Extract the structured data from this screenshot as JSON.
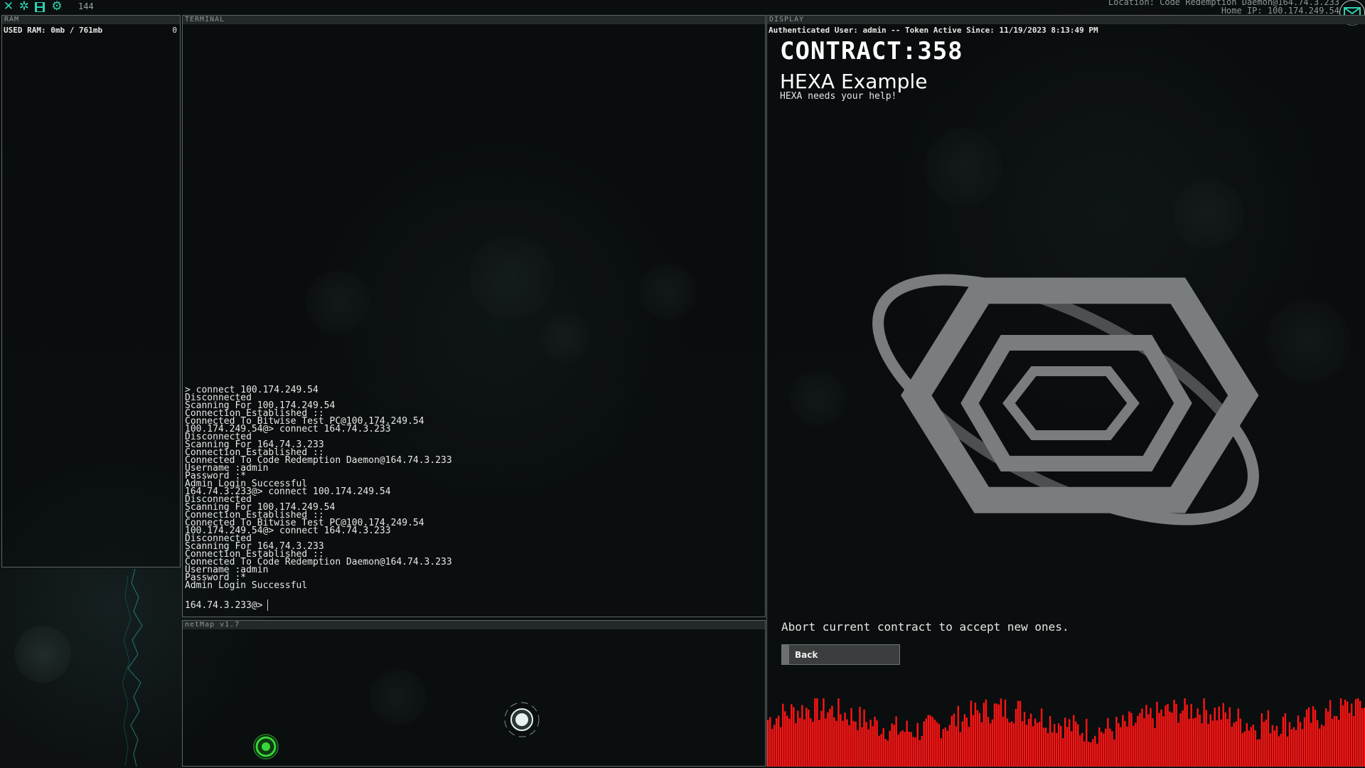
{
  "topbar": {
    "icons": [
      "close-icon",
      "settings-icon",
      "save-icon",
      "gear-icon"
    ],
    "count": "144",
    "location_line": "Location: Code Redemption Daemon@164.74.3.233",
    "home_ip_line": "Home IP: 100.174.249.54"
  },
  "ram": {
    "header": "RAM",
    "used": "USED RAM: 0mb / 761mb",
    "count": "0"
  },
  "terminal": {
    "header": "TERMINAL",
    "log": [
      "> connect 100.174.249.54",
      "Disconnected",
      "Scanning For 100.174.249.54",
      "Connection Established ::",
      "Connected To Bitwise Test PC@100.174.249.54",
      "100.174.249.54@> connect 164.74.3.233",
      "Disconnected",
      "Scanning For 164.74.3.233",
      "Connection Established ::",
      "Connected To Code Redemption Daemon@164.74.3.233",
      "Username :admin",
      "Password :*",
      "Admin Login Successful",
      "164.74.3.233@> connect 100.174.249.54",
      "Disconnected",
      "Scanning For 100.174.249.54",
      "Connection Established ::",
      "Connected To Bitwise Test PC@100.174.249.54",
      "100.174.249.54@> connect 164.74.3.233",
      "Disconnected",
      "Scanning For 164.74.3.233",
      "Connection Established ::",
      "Connected To Code Redemption Daemon@164.74.3.233",
      "Username :admin",
      "Password :*",
      "Admin Login Successful"
    ],
    "prompt": "164.74.3.233@>"
  },
  "netmap": {
    "header": "netMap v1.7",
    "colors": {
      "home_node": "#37d63a",
      "remote_node": "#e8f2f2"
    }
  },
  "display": {
    "header": "DISPLAY",
    "auth_line": "Authenticated User: admin -- Token Active Since: 11/19/2023 8:13:49 PM",
    "contract_title": "CONTRACT:358",
    "contract_name": "HEXA Example",
    "contract_sub": "HEXA needs your help!",
    "abort_message": "Abort current contract to accept new ones.",
    "back_label": "Back",
    "logo": "hexa-logo",
    "traffic_color": "#ff1414"
  }
}
